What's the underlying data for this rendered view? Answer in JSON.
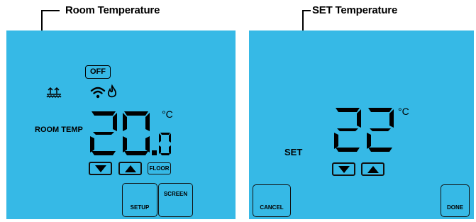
{
  "left": {
    "callout": "Room Temperature",
    "off_badge": "OFF",
    "label": "ROOM TEMP",
    "temperature_int": "20",
    "temperature_dec": "0",
    "unit": "°C",
    "floor_button": "FLOOR",
    "setup_button": "SETUP",
    "screen_button": "SCREEN"
  },
  "right": {
    "callout": "SET Temperature",
    "label": "SET",
    "temperature": "22",
    "unit": "°C",
    "cancel_button": "CANCEL",
    "done_button": "DONE"
  },
  "colors": {
    "lcd_background": "#36b9e6",
    "segment": "#000000"
  },
  "icons": [
    "floor-heat-icon",
    "wifi-icon",
    "flame-icon",
    "down-arrow-icon",
    "up-arrow-icon"
  ]
}
